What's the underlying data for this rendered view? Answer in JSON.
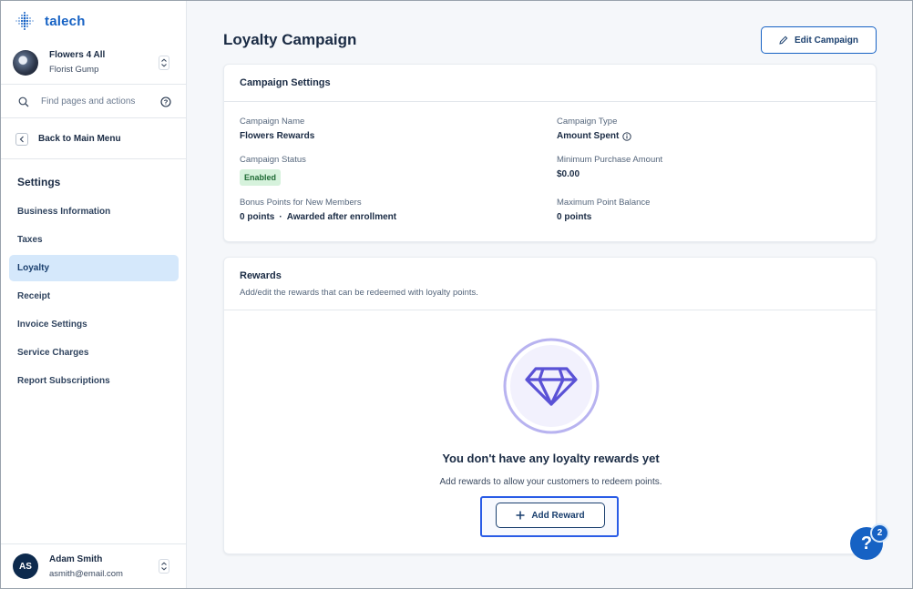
{
  "app": {
    "brand": "talech"
  },
  "account": {
    "name": "Flowers 4 All",
    "sub": "Florist Gump"
  },
  "search": {
    "placeholder": "Find pages and actions"
  },
  "back": {
    "label": "Back to Main Menu"
  },
  "settings_nav": {
    "title": "Settings",
    "items": [
      {
        "label": "Business Information",
        "active": false
      },
      {
        "label": "Taxes",
        "active": false
      },
      {
        "label": "Loyalty",
        "active": true
      },
      {
        "label": "Receipt",
        "active": false
      },
      {
        "label": "Invoice Settings",
        "active": false
      },
      {
        "label": "Service Charges",
        "active": false
      },
      {
        "label": "Report Subscriptions",
        "active": false
      }
    ]
  },
  "user": {
    "initials": "AS",
    "name": "Adam Smith",
    "email": "asmith@email.com"
  },
  "page": {
    "title": "Loyalty Campaign",
    "edit_button": "Edit Campaign"
  },
  "campaign_settings": {
    "title": "Campaign Settings",
    "campaign_name_label": "Campaign Name",
    "campaign_name_value": "Flowers Rewards",
    "campaign_type_label": "Campaign Type",
    "campaign_type_value": "Amount Spent",
    "campaign_status_label": "Campaign Status",
    "campaign_status_value": "Enabled",
    "min_purchase_label": "Minimum Purchase Amount",
    "min_purchase_value": "$0.00",
    "bonus_points_label": "Bonus Points for New Members",
    "bonus_points_value": "0 points",
    "bonus_points_separator": "·",
    "bonus_points_note": "Awarded after enrollment",
    "max_balance_label": "Maximum Point Balance",
    "max_balance_value": "0 points"
  },
  "rewards": {
    "title": "Rewards",
    "subtitle": "Add/edit the rewards that can be redeemed with loyalty points.",
    "empty_title": "You don't have any loyalty rewards yet",
    "empty_subtitle": "Add rewards to allow your customers to redeem points.",
    "add_button": "Add Reward"
  },
  "help": {
    "badge_count": "2",
    "symbol": "?"
  },
  "colors": {
    "accent": "#1662c4",
    "active_nav": "#d5e8fb",
    "enabled_badge": "#d6f2dc",
    "highlight": "#2a5ce6",
    "diamond": "#5a52d6"
  }
}
